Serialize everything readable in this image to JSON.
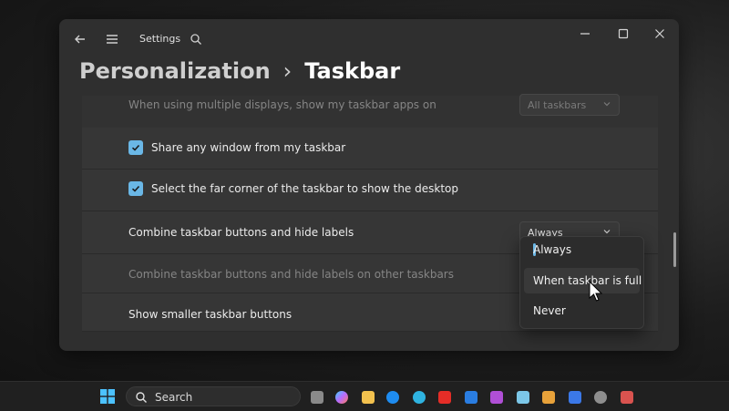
{
  "window": {
    "app_title": "Settings",
    "breadcrumb": {
      "parent": "Personalization",
      "separator": "›",
      "current": "Taskbar"
    },
    "controls": [
      "back-icon",
      "menu-icon",
      "search-icon",
      "minimize-icon",
      "maximize-icon",
      "close-icon"
    ]
  },
  "settings": {
    "multi_display": {
      "label": "When using multiple displays, show my taskbar apps on",
      "value": "All taskbars"
    },
    "share_window": {
      "label": "Share any window from my taskbar",
      "checked": true
    },
    "far_corner": {
      "label": "Select the far corner of the taskbar to show the desktop",
      "checked": true
    },
    "combine_buttons": {
      "label": "Combine taskbar buttons and hide labels",
      "value": "Always"
    },
    "combine_other": {
      "label": "Combine taskbar buttons and hide labels on other taskbars"
    },
    "smaller_buttons": {
      "label": "Show smaller taskbar buttons"
    }
  },
  "dropdown": {
    "options": [
      "Always",
      "When taskbar is full",
      "Never"
    ],
    "selected": "Always",
    "hovered": "When taskbar is full"
  },
  "taskbar": {
    "search_label": "Search",
    "accent": "#6ab7e6"
  }
}
